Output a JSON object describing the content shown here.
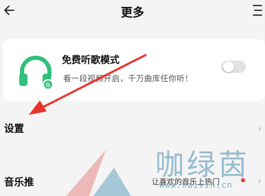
{
  "header": {
    "title": "更多"
  },
  "card": {
    "title": "免费听歌模式",
    "description": "看一段视频开启，千万曲库任你听！",
    "toggle_on": false,
    "accent_color": "#2fc07a"
  },
  "rows": {
    "settings": {
      "label": "设置"
    },
    "music": {
      "label": "音乐推",
      "subtitle": "让喜欢的音乐上热门"
    }
  },
  "watermark": {
    "text": "咖绿茵",
    "url": "www.kaivin.cn"
  },
  "colors": {
    "annotation_arrow": "#e8322e",
    "background": "#f4f4f4"
  }
}
